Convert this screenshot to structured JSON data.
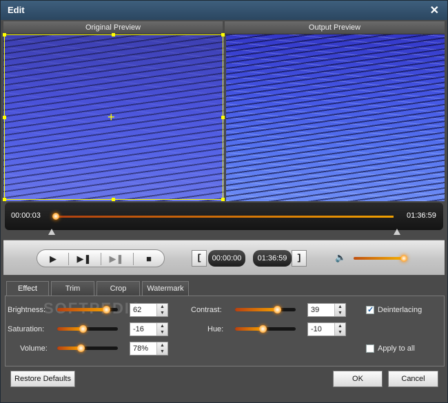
{
  "window": {
    "title": "Edit",
    "close_glyph": "✕"
  },
  "preview": {
    "original_label": "Original Preview",
    "output_label": "Output Preview"
  },
  "timeline": {
    "start_time": "00:00:03",
    "end_time": "01:36:59",
    "playhead_fraction": 0.0
  },
  "controls": {
    "play_icon": "play-icon",
    "next_frame_icon": "step-forward-icon",
    "snapshot_icon": "clip-icon",
    "stop_icon": "stop-icon",
    "start_bracket": "[",
    "start_time": "00:00:00",
    "end_time": "01:36:59",
    "end_bracket": "]",
    "volume_level": 1.0
  },
  "tabs": [
    {
      "label": "Effect",
      "active": true
    },
    {
      "label": "Trim",
      "active": false
    },
    {
      "label": "Crop",
      "active": false
    },
    {
      "label": "Watermark",
      "active": false
    }
  ],
  "effect": {
    "brightness": {
      "label": "Brightness:",
      "value": "62",
      "level": 0.81
    },
    "saturation": {
      "label": "Saturation:",
      "value": "-16",
      "level": 0.42
    },
    "volume": {
      "label": "Volume:",
      "value": "78%",
      "level": 0.39
    },
    "contrast": {
      "label": "Contrast:",
      "value": "39",
      "level": 0.69
    },
    "hue": {
      "label": "Hue:",
      "value": "-10",
      "level": 0.45
    },
    "deinterlacing": {
      "label": "Deinterlacing",
      "checked": true
    },
    "apply_to_all": {
      "label": "Apply to all",
      "checked": false
    }
  },
  "watermark_text": "SOFTPEDIA",
  "buttons": {
    "restore_defaults": "Restore Defaults",
    "ok": "OK",
    "cancel": "Cancel"
  },
  "colors": {
    "accent_orange": "#ff8a00",
    "titlebar": "#2b4660",
    "crop_frame": "#ffff00"
  }
}
